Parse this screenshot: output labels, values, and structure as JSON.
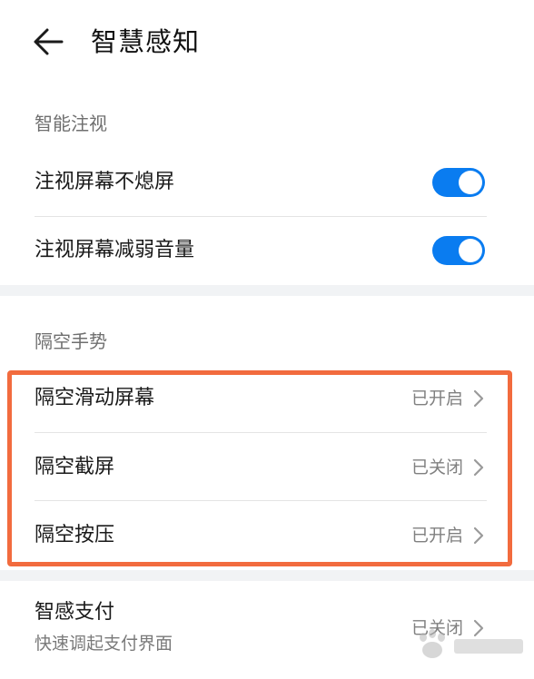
{
  "header": {
    "title": "智慧感知"
  },
  "sections": {
    "gaze": {
      "label": "智能注视",
      "items": [
        {
          "label": "注视屏幕不熄屏",
          "toggle": "on"
        },
        {
          "label": "注视屏幕减弱音量",
          "toggle": "on"
        }
      ]
    },
    "air_gesture": {
      "label": "隔空手势",
      "items": [
        {
          "label": "隔空滑动屏幕",
          "value": "已开启"
        },
        {
          "label": "隔空截屏",
          "value": "已关闭"
        },
        {
          "label": "隔空按压",
          "value": "已开启"
        }
      ]
    },
    "payment": {
      "label": "智感支付",
      "sublabel": "快速调起支付界面",
      "value": "已关闭"
    }
  },
  "colors": {
    "accent": "#0a7cf0",
    "highlight": "#f26b3e",
    "band": "#f1f3f5"
  },
  "icons": {
    "back": "arrow-left-icon",
    "chevron": "chevron-right-icon"
  }
}
